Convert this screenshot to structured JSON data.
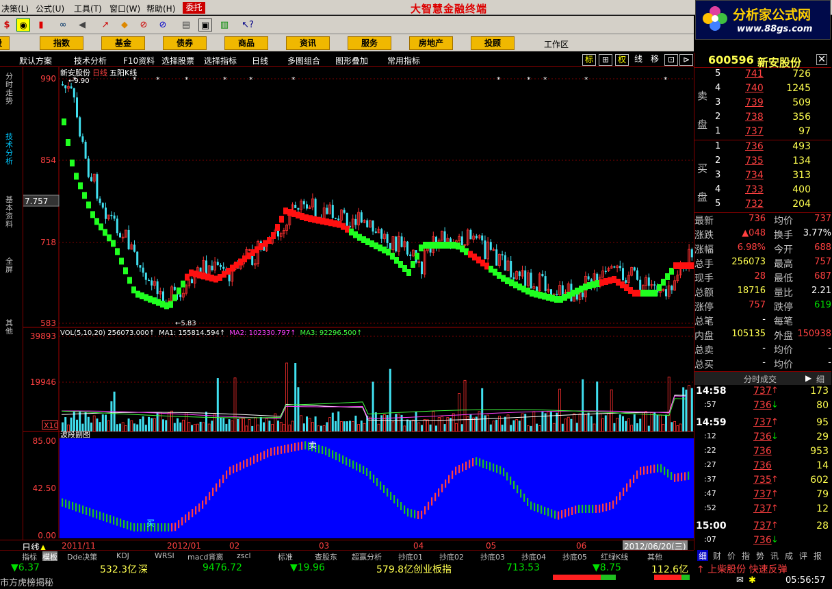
{
  "menu": {
    "items": [
      "决策(L)",
      "公式(U)",
      "工具(T)",
      "窗口(W)",
      "帮助(H)"
    ],
    "trust": "委托",
    "title": "大智慧金融终端"
  },
  "logo": {
    "main": "分析家公式网",
    "url": "www.88gs.com"
  },
  "nav": {
    "items": [
      "股",
      "指数",
      "基金",
      "债券",
      "商品",
      "资讯",
      "服务",
      "房地产",
      "投顾"
    ],
    "workspace": "工作区"
  },
  "subbar": {
    "items": [
      "默认方案",
      "技术分析",
      "F10资料",
      "选择股票",
      "选择指标",
      "日线",
      "多图组合",
      "图形叠加",
      "常用指标"
    ],
    "buttons": [
      "标",
      "⊞",
      "权",
      "线",
      "移",
      "⊡",
      "⊳"
    ]
  },
  "left_tabs": [
    "分时走势",
    "技术分析",
    "基本资料",
    "全屏",
    "其他"
  ],
  "kline": {
    "title": "新安股份 日线 五阳线",
    "stock_name": "新安股份",
    "period": "日线",
    "indicator": "五阳K线",
    "y_ticks": [
      "990",
      "854",
      "7.757",
      "718",
      "583"
    ],
    "high_label": "9.90",
    "low_label": "5.83"
  },
  "vol": {
    "legend": "VOL(5,10,20) 256073.000↑",
    "ma1": "MA1: 155814.594↑",
    "ma2": "MA2: 102330.797↑",
    "ma3": "MA3: 92296.500↑",
    "y_ticks": [
      "39893",
      "19946",
      "X10"
    ]
  },
  "wave": {
    "title": "波段副图",
    "y_ticks": [
      "85.00",
      "42.50",
      "0.00"
    ],
    "buy": "买",
    "sell": "卖"
  },
  "x_axis": {
    "period_label": "日线",
    "dates": [
      "2011/11",
      "2012/01",
      "02",
      "03",
      "04",
      "05",
      "06"
    ],
    "cursor_date": "2012/06/20(三)"
  },
  "bottom_tabs": [
    "指标",
    "模板",
    "Dde决策",
    "KDJ",
    "WRSI",
    "macd背离",
    "zscl",
    "标准",
    "查股东",
    "超赢分析",
    "抄底01",
    "抄底02",
    "抄底03",
    "抄底04",
    "抄底05",
    "红绿K线",
    "其他"
  ],
  "quote": {
    "code": "600596",
    "name": "新安股份",
    "sell_label": "卖盘",
    "buy_label": "买盘",
    "sell": [
      {
        "n": "5",
        "p": "741",
        "v": "726"
      },
      {
        "n": "4",
        "p": "740",
        "v": "1245"
      },
      {
        "n": "3",
        "p": "739",
        "v": "509"
      },
      {
        "n": "2",
        "p": "738",
        "v": "356"
      },
      {
        "n": "1",
        "p": "737",
        "v": "97"
      }
    ],
    "buy": [
      {
        "n": "1",
        "p": "736",
        "v": "493"
      },
      {
        "n": "2",
        "p": "735",
        "v": "134"
      },
      {
        "n": "3",
        "p": "734",
        "v": "313"
      },
      {
        "n": "4",
        "p": "733",
        "v": "400"
      },
      {
        "n": "5",
        "p": "732",
        "v": "204"
      }
    ],
    "stats": [
      {
        "l1": "最新",
        "v1": "736",
        "l2": "均价",
        "v2": "737"
      },
      {
        "l1": "涨跌",
        "v1": "▲048",
        "l2": "换手",
        "v2": "3.77%"
      },
      {
        "l1": "涨幅",
        "v1": "6.98%",
        "l2": "今开",
        "v2": "688"
      },
      {
        "l1": "总手",
        "v1": "256073",
        "l2": "最高",
        "v2": "757"
      },
      {
        "l1": "现手",
        "v1": "28",
        "l2": "最低",
        "v2": "687"
      },
      {
        "l1": "总额",
        "v1": "18716",
        "l2": "量比",
        "v2": "2.21"
      },
      {
        "l1": "涨停",
        "v1": "757",
        "l2": "跌停",
        "v2": "619"
      },
      {
        "l1": "总笔",
        "v1": "-",
        "l2": "每笔",
        "v2": ""
      },
      {
        "l1": "内盘",
        "v1": "105135",
        "l2": "外盘",
        "v2": "150938"
      },
      {
        "l1": "总卖",
        "v1": "-",
        "l2": "均价",
        "v2": "-"
      },
      {
        "l1": "总买",
        "v1": "-",
        "l2": "均价",
        "v2": "-"
      }
    ],
    "ticks_title": "分时成交",
    "detail_btn": "细",
    "ticks": [
      {
        "t": "14:58",
        "p": "737",
        "d": "up",
        "v": "173"
      },
      {
        "t": ":57",
        "p": "736",
        "d": "dn",
        "v": "80"
      },
      {
        "t": "14:59",
        "p": "737",
        "d": "up",
        "v": "95"
      },
      {
        "t": ":12",
        "p": "736",
        "d": "dn",
        "v": "29"
      },
      {
        "t": ":22",
        "p": "736",
        "d": "",
        "v": "953"
      },
      {
        "t": ":27",
        "p": "736",
        "d": "",
        "v": "14"
      },
      {
        "t": ":37",
        "p": "735",
        "d": "up",
        "v": "602"
      },
      {
        "t": ":47",
        "p": "737",
        "d": "up",
        "v": "79"
      },
      {
        "t": ":52",
        "p": "737",
        "d": "up",
        "v": "12"
      },
      {
        "t": "15:00",
        "p": "737",
        "d": "up",
        "v": "28"
      },
      {
        "t": ":07",
        "p": "736",
        "d": "dn",
        "v": ""
      }
    ],
    "tabs": [
      "细",
      "财",
      "价",
      "指",
      "势",
      "讯",
      "成",
      "评",
      "报"
    ]
  },
  "status": {
    "sh_change": "▼6.37",
    "sh_amount": "532.3亿",
    "sz_label": "深",
    "sz_index": "9476.72",
    "sz_change": "▼19.96",
    "sz_amount": "579.8亿",
    "cy_label": "创业板指",
    "cy_index": "713.53",
    "cy_change": "▼8.75",
    "cy_amount": "112.6亿",
    "news": "↑ 上柴股份 快速反弹",
    "ticker": "市方虎榜揭秘",
    "time": "05:56:57"
  }
}
